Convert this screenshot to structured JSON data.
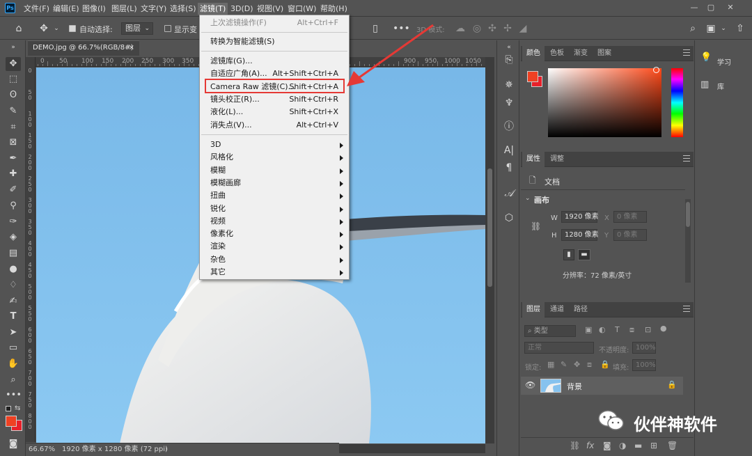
{
  "menubar": {
    "items": [
      "文件(F)",
      "编辑(E)",
      "图像(I)",
      "图层(L)",
      "文字(Y)",
      "选择(S)",
      "滤镜(T)",
      "3D(D)",
      "视图(V)",
      "窗口(W)",
      "帮助(H)"
    ],
    "active": "滤镜(T)"
  },
  "window_controls": {
    "minimize": "—",
    "restore": "▢",
    "close": "✕"
  },
  "options_bar": {
    "auto_select_label": "自动选择:",
    "auto_select_target": "图层",
    "show_transform_label": "显示变",
    "mode_3d_label": "3D 模式:"
  },
  "document": {
    "tab_title": "DEMO.jpg @ 66.7%(RGB/8#)",
    "tab_close": "×"
  },
  "ruler_top": [
    "0",
    "50",
    "100",
    "150",
    "200",
    "250",
    "300",
    "350",
    "900",
    "950",
    "1000",
    "1050"
  ],
  "ruler_left": [
    "0",
    "50",
    "100",
    "150",
    "200",
    "250",
    "300",
    "350",
    "400",
    "450",
    "500",
    "550",
    "600",
    "650",
    "700",
    "750",
    "800"
  ],
  "status": {
    "zoom": "66.67%",
    "doc_info": "1920 像素 x 1280 像素 (72 ppi)",
    "arrow": "›"
  },
  "filter_menu": {
    "items": [
      {
        "label": "上次滤镜操作(F)",
        "shortcut": "Alt+Ctrl+F",
        "disabled": true
      },
      {
        "label": "转换为智能滤镜(S)",
        "shortcut": ""
      },
      {
        "label": "滤镜库(G)...",
        "shortcut": ""
      },
      {
        "label": "自适应广角(A)...",
        "shortcut": "Alt+Shift+Ctrl+A"
      },
      {
        "label": "Camera Raw 滤镜(C)...",
        "shortcut": "Shift+Ctrl+A",
        "highlighted": true
      },
      {
        "label": "镜头校正(R)...",
        "shortcut": "Shift+Ctrl+R"
      },
      {
        "label": "液化(L)...",
        "shortcut": "Shift+Ctrl+X"
      },
      {
        "label": "消失点(V)...",
        "shortcut": "Alt+Ctrl+V"
      }
    ],
    "submenus": [
      "3D",
      "风格化",
      "模糊",
      "模糊画廊",
      "扭曲",
      "锐化",
      "视频",
      "像素化",
      "渲染",
      "杂色",
      "其它"
    ],
    "highlight_color": "#e53935"
  },
  "color_panel": {
    "tabs": [
      "颜色",
      "色板",
      "渐变",
      "图案"
    ],
    "foreground": "#ef4123",
    "background": "#e8202a",
    "hue_base": "#ff4a1a"
  },
  "properties_panel": {
    "tabs": [
      "属性",
      "调整"
    ],
    "doc_label": "文档",
    "section": "画布",
    "w_label": "W",
    "w_value": "1920 像素",
    "h_label": "H",
    "h_value": "1280 像素",
    "x_label": "X",
    "x_value": "0 像素",
    "y_label": "Y",
    "y_value": "0 像素",
    "resolution": "分辨率：72 像素/英寸"
  },
  "layers_panel": {
    "tabs": [
      "图层",
      "通道",
      "路径"
    ],
    "filter_kind": "类型",
    "blend_mode": "正常",
    "opacity_label": "不透明度:",
    "opacity_value": "100%",
    "lock_label": "锁定:",
    "fill_label": "填充:",
    "fill_value": "100%",
    "layers": [
      {
        "name": "背景",
        "visible": true,
        "locked": true
      }
    ]
  },
  "right_strip": {
    "items": [
      {
        "label": "学习"
      },
      {
        "label": "库"
      }
    ]
  },
  "watermark": {
    "text": "伙伴神软件"
  }
}
